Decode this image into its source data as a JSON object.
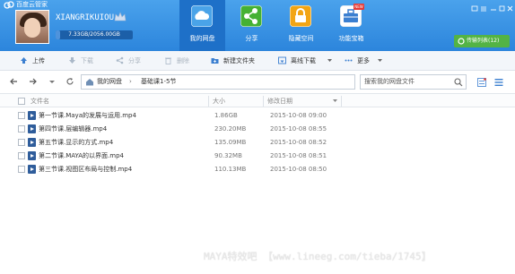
{
  "app": {
    "title": "百度云管家"
  },
  "user": {
    "name": "XIANGRIKUIOU",
    "quota_text": "7.33GB/2056.00GB",
    "quota_fraction": 0.0036
  },
  "nav_tabs": [
    {
      "label": "我的网盘",
      "icon": "cloud-icon",
      "color": "#4aa3e8",
      "active": true
    },
    {
      "label": "分享",
      "icon": "share-icon",
      "color": "#45b134",
      "active": false
    },
    {
      "label": "隐藏空间",
      "icon": "lock-icon",
      "color": "#f2a515",
      "active": false
    },
    {
      "label": "功能宝箱",
      "icon": "toolbox-icon",
      "color": "#ffffff",
      "active": false,
      "badge": "NEW"
    }
  ],
  "transfer_button": {
    "label": "传输列表(12)",
    "color": "#53b345"
  },
  "toolbar": {
    "upload": "上传",
    "download": "下载",
    "share": "分享",
    "delete": "删除",
    "new_folder": "新建文件夹",
    "offline_download": "离线下载",
    "more": "更多"
  },
  "path": {
    "root": "我的网盘",
    "separator": "›",
    "current": "基础课1-5节"
  },
  "search": {
    "placeholder": "搜索我的网盘文件"
  },
  "columns": {
    "name": "文件名",
    "size": "大小",
    "modified": "修改日期"
  },
  "files": [
    {
      "name": "第一节课.Maya的发展与运用.mp4",
      "size": "1.86GB",
      "date": "2015-10-08 09:00"
    },
    {
      "name": "第四节课.层编辑器.mp4",
      "size": "230.20MB",
      "date": "2015-10-08 08:55"
    },
    {
      "name": "第五节课.显示的方式.mp4",
      "size": "135.09MB",
      "date": "2015-10-08 08:52"
    },
    {
      "name": "第二节课.MAYA的以界面.mp4",
      "size": "90.32MB",
      "date": "2015-10-08 08:51"
    },
    {
      "name": "第三节课.视图区布局与控制.mp4",
      "size": "110.13MB",
      "date": "2015-10-08 08:50"
    }
  ],
  "watermark": "MAYA特效吧 【www.lineeg.com/tieba/1745】"
}
